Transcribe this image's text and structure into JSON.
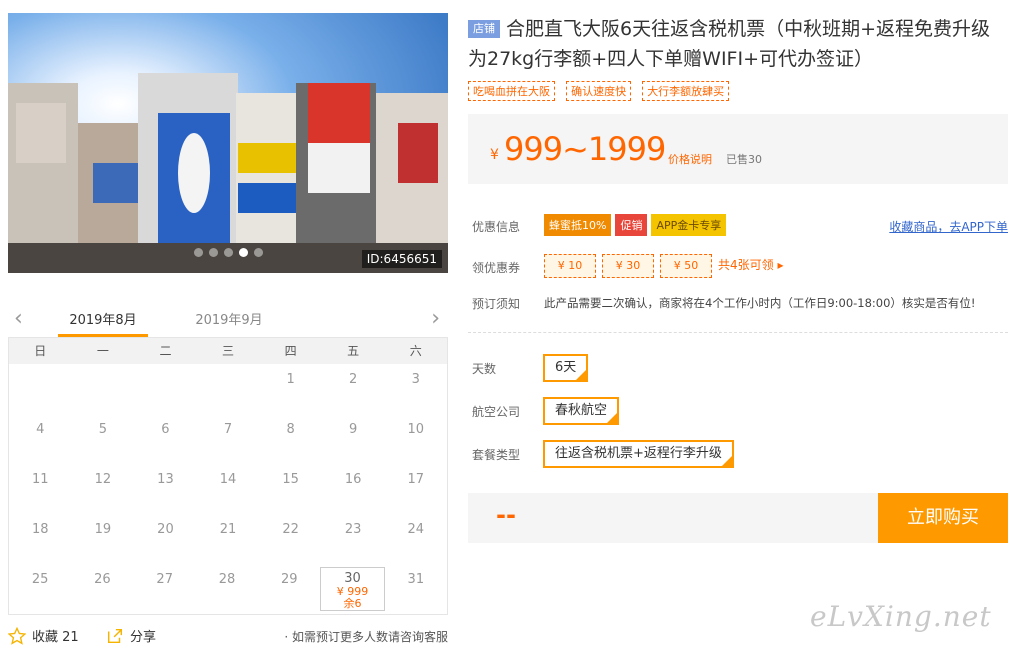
{
  "photo": {
    "id_label": "ID:6456651",
    "dots": 5,
    "active_dot": 3
  },
  "calendar": {
    "tabs": [
      "2019年8月",
      "2019年9月"
    ],
    "weekdays": [
      "日",
      "一",
      "二",
      "三",
      "四",
      "五",
      "六"
    ],
    "rows": [
      [
        "",
        "",
        "",
        "",
        "1",
        "2",
        "3"
      ],
      [
        "4",
        "5",
        "6",
        "7",
        "8",
        "9",
        "10"
      ],
      [
        "11",
        "12",
        "13",
        "14",
        "15",
        "16",
        "17"
      ],
      [
        "18",
        "19",
        "20",
        "21",
        "22",
        "23",
        "24"
      ],
      [
        "25",
        "26",
        "27",
        "28",
        "29",
        "30",
        "31"
      ]
    ],
    "selected": {
      "day": "30",
      "price": "¥ 999",
      "remain": "余6"
    }
  },
  "bottom": {
    "fav_label": "收藏 21",
    "share_label": "分享",
    "note": "· 如需预订更多人数请咨询客服"
  },
  "product": {
    "shop_badge": "店铺",
    "title": "合肥直飞大阪6天往返含税机票（中秋班期+返程免费升级为27kg行李额+四人下单赠WIFI+可代办签证）",
    "tags": [
      "吃喝血拼在大阪",
      "确认速度快",
      "大行李额放肆买"
    ]
  },
  "price": {
    "yen": "¥",
    "range": "999~1999",
    "explain": "价格说明",
    "sold": "已售30"
  },
  "promo": {
    "label": "优惠信息",
    "pills": [
      {
        "text": "蜂蜜抵10%",
        "color": "#f08a00"
      },
      {
        "text": "促销",
        "color": "#e8463a"
      },
      {
        "text": "APP金卡专享",
        "color": "#f5c400"
      }
    ],
    "fav_link": "收藏商品，去APP下单"
  },
  "coupons": {
    "label": "领优惠券",
    "items": [
      "¥ 10",
      "¥ 30",
      "¥ 50"
    ],
    "more": "共4张可领"
  },
  "notice": {
    "label": "预订须知",
    "text": "此产品需要二次确认，商家将在4个工作小时内（工作日9:00-18:00）核实是否有位!"
  },
  "options": {
    "days": {
      "label": "天数",
      "value": "6天"
    },
    "airline": {
      "label": "航空公司",
      "value": "春秋航空"
    },
    "package": {
      "label": "套餐类型",
      "value": "往返含税机票+返程行李升级"
    }
  },
  "buy": {
    "price_placeholder": "--",
    "button": "立即购买"
  },
  "watermark": "eLvXing.net"
}
